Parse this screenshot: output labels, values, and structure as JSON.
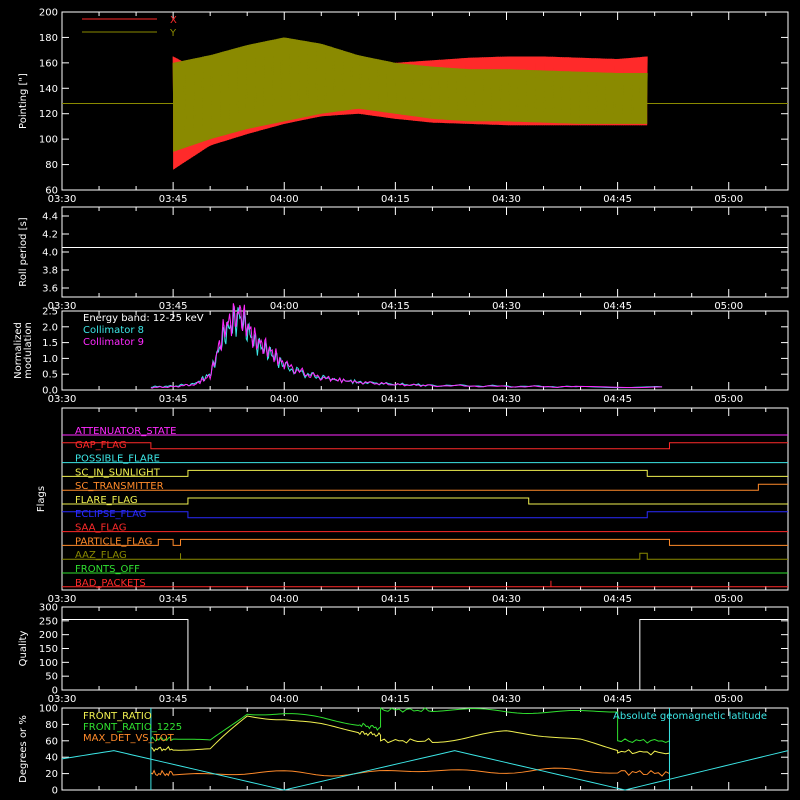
{
  "time_ticks": [
    "03:30",
    "03:45",
    "04:00",
    "04:15",
    "04:30",
    "04:45",
    "05:00"
  ],
  "colors": {
    "background": "#000000",
    "axes": "#ffffff",
    "red": "#ff2a2a",
    "olive": "#8a8a00",
    "cyan": "#3ce6e6",
    "magenta": "#ff2aff",
    "yellow": "#f0f050",
    "green": "#30e030",
    "orange": "#ff8a2a",
    "blue": "#2a2aff"
  },
  "chart_data": [
    {
      "type": "line",
      "panel": "pointing",
      "ylabel": "Pointing [\"]",
      "ylim": [
        60,
        200
      ],
      "yticks": [
        "60",
        "80",
        "100",
        "120",
        "140",
        "160",
        "180",
        "200"
      ],
      "legend_placement": "top-left",
      "series": [
        {
          "name": "X",
          "color": "#ff2a2a",
          "x": [
            "03:45",
            "03:50",
            "03:55",
            "04:00",
            "04:05",
            "04:10",
            "04:15",
            "04:20",
            "04:25",
            "04:30",
            "04:35",
            "04:40",
            "04:45",
            "04:49"
          ],
          "upper": [
            165,
            150,
            152,
            154,
            156,
            158,
            160,
            162,
            164,
            165,
            165,
            164,
            163,
            165
          ],
          "lower": [
            76,
            95,
            104,
            112,
            118,
            120,
            116,
            113,
            112,
            111,
            111,
            111,
            111,
            111
          ]
        },
        {
          "name": "Y",
          "color": "#8a8a00",
          "reference_line": 128,
          "x": [
            "03:45",
            "03:50",
            "03:55",
            "04:00",
            "04:05",
            "04:10",
            "04:15",
            "04:20",
            "04:25",
            "04:30",
            "04:35",
            "04:40",
            "04:45",
            "04:49"
          ],
          "upper": [
            160,
            166,
            174,
            180,
            175,
            166,
            160,
            157,
            155,
            155,
            154,
            153,
            152,
            152
          ],
          "lower": [
            90,
            100,
            108,
            114,
            120,
            124,
            120,
            116,
            114,
            114,
            113,
            112,
            112,
            112
          ]
        }
      ]
    },
    {
      "type": "line",
      "panel": "roll_period",
      "ylabel": "Roll period [s]",
      "ylim": [
        3.5,
        4.5
      ],
      "yticks": [
        "3.6",
        "3.8",
        "4.0",
        "4.2",
        "4.4"
      ],
      "series": [
        {
          "color": "#ffffff",
          "x": [
            "03:30",
            "05:08"
          ],
          "y": [
            4.05,
            4.05
          ]
        }
      ]
    },
    {
      "type": "line",
      "panel": "modulation",
      "ylabel": "Normalized modulation",
      "ylim": [
        0,
        2.5
      ],
      "yticks": [
        "0.0",
        "0.5",
        "1.0",
        "1.5",
        "2.0",
        "2.5"
      ],
      "annotation": "Energy band: 12-25 keV",
      "series": [
        {
          "name": "Collimator 8",
          "color": "#3ce6e6",
          "x": [
            "03:42",
            "03:45",
            "03:48",
            "03:50",
            "03:52",
            "03:54",
            "03:56",
            "03:58",
            "04:00",
            "04:03",
            "04:06",
            "04:10",
            "04:15",
            "04:20",
            "04:30",
            "04:40",
            "04:51"
          ],
          "y": [
            0.1,
            0.12,
            0.2,
            0.5,
            1.8,
            2.35,
            1.5,
            1.2,
            0.75,
            0.5,
            0.35,
            0.25,
            0.18,
            0.15,
            0.12,
            0.1,
            0.1
          ]
        },
        {
          "name": "Collimator 9",
          "color": "#ff2aff",
          "x": [
            "03:42",
            "03:45",
            "03:48",
            "03:50",
            "03:52",
            "03:54",
            "03:56",
            "03:58",
            "04:00",
            "04:03",
            "04:06",
            "04:10",
            "04:15",
            "04:20",
            "04:30",
            "04:40",
            "04:51"
          ],
          "y": [
            0.08,
            0.1,
            0.18,
            0.45,
            2.0,
            2.45,
            1.6,
            1.25,
            0.8,
            0.5,
            0.35,
            0.25,
            0.17,
            0.14,
            0.11,
            0.1,
            0.1
          ]
        }
      ]
    },
    {
      "type": "line",
      "panel": "flags",
      "ylabel": "Flags",
      "series": [
        {
          "name": "ATTENUATOR_STATE",
          "color": "#ff2aff",
          "steps": [
            [
              "03:30",
              0
            ]
          ]
        },
        {
          "name": "GAP_FLAG",
          "color": "#ff2a2a",
          "steps": [
            [
              "03:30",
              1
            ],
            [
              "03:42",
              0
            ],
            [
              "04:52",
              1
            ]
          ]
        },
        {
          "name": "POSSIBLE_FLARE",
          "color": "#3ce6e6",
          "steps": [
            [
              "03:30",
              0
            ]
          ]
        },
        {
          "name": "SC_IN_SUNLIGHT",
          "color": "#f0f050",
          "steps": [
            [
              "03:30",
              0
            ],
            [
              "03:47",
              1
            ],
            [
              "04:49",
              0
            ]
          ]
        },
        {
          "name": "SC_TRANSMITTER",
          "color": "#ff8a2a",
          "steps": [
            [
              "03:30",
              0
            ],
            [
              "05:04",
              1
            ]
          ]
        },
        {
          "name": "FLARE_FLAG",
          "color": "#f0f050",
          "steps": [
            [
              "03:30",
              0
            ],
            [
              "03:47",
              1
            ],
            [
              "04:33",
              0
            ]
          ]
        },
        {
          "name": "ECLIPSE_FLAG",
          "color": "#2a2aff",
          "steps": [
            [
              "03:30",
              1
            ],
            [
              "03:47",
              0
            ],
            [
              "04:49",
              1
            ]
          ]
        },
        {
          "name": "SAA_FLAG",
          "color": "#ff2a2a",
          "steps": [
            [
              "03:30",
              0
            ]
          ]
        },
        {
          "name": "PARTICLE_FLAG",
          "color": "#ff8a2a",
          "steps": [
            [
              "03:30",
              0
            ],
            [
              "03:43",
              1
            ],
            [
              "03:45",
              0
            ],
            [
              "03:46",
              1
            ],
            [
              "04:52",
              0
            ]
          ]
        },
        {
          "name": "AAZ_FLAG",
          "color": "#8a8a00",
          "steps": [
            [
              "03:30",
              0
            ],
            [
              "03:46",
              1
            ],
            [
              "03:46",
              0
            ],
            [
              "04:48",
              1
            ],
            [
              "04:49",
              0
            ]
          ]
        },
        {
          "name": "FRONTS_OFF",
          "color": "#30e030",
          "steps": [
            [
              "03:30",
              0
            ]
          ]
        },
        {
          "name": "BAD_PACKETS",
          "color": "#ff2a2a",
          "steps": [
            [
              "03:30",
              0
            ],
            [
              "04:36",
              1
            ],
            [
              "04:36",
              0
            ]
          ]
        }
      ]
    },
    {
      "type": "line",
      "panel": "quality",
      "ylabel": "Quality",
      "ylim": [
        0,
        300
      ],
      "yticks": [
        "0",
        "50",
        "100",
        "150",
        "200",
        "250",
        "300"
      ],
      "series": [
        {
          "color": "#ffffff",
          "x": [
            "03:30",
            "03:47",
            "03:47",
            "04:48",
            "04:48",
            "05:08"
          ],
          "y": [
            255,
            255,
            0,
            0,
            255,
            255
          ]
        }
      ]
    },
    {
      "type": "line",
      "panel": "ratios",
      "ylabel": "Degrees or %",
      "ylim": [
        0,
        100
      ],
      "yticks": [
        "0",
        "20",
        "40",
        "60",
        "80",
        "100"
      ],
      "series": [
        {
          "name": "FRONT_RATIO",
          "color": "#f0f050",
          "x": [
            "03:42",
            "03:45",
            "03:50",
            "03:55",
            "04:00",
            "04:05",
            "04:10",
            "04:13",
            "04:13",
            "04:20",
            "04:25",
            "04:30",
            "04:40",
            "04:45",
            "04:45",
            "04:52"
          ],
          "y": [
            50,
            50,
            48,
            90,
            88,
            80,
            70,
            67,
            60,
            60,
            65,
            70,
            62,
            50,
            47,
            45
          ]
        },
        {
          "name": "FRONT_RATIO_1225",
          "color": "#30e030",
          "x": [
            "03:42",
            "03:45",
            "03:50",
            "03:55",
            "04:00",
            "04:05",
            "04:10",
            "04:13",
            "04:13",
            "04:20",
            "04:30",
            "04:40",
            "04:45",
            "04:45",
            "04:52"
          ],
          "y": [
            62,
            62,
            60,
            95,
            92,
            87,
            80,
            75,
            98,
            97,
            96,
            96,
            95,
            60,
            60
          ]
        },
        {
          "name": "MAX_DET_VS_TOT",
          "color": "#ff8a2a",
          "x": [
            "03:42",
            "03:45",
            "04:00",
            "04:15",
            "04:30",
            "04:45",
            "04:52"
          ],
          "y": [
            20,
            20,
            20,
            22,
            24,
            22,
            20
          ]
        },
        {
          "name": "Absolute geomagnetic latitude",
          "color": "#3ce6e6",
          "x": [
            "03:30",
            "03:37",
            "04:00",
            "04:23",
            "04:46",
            "05:08"
          ],
          "y": [
            38,
            48,
            0,
            48,
            0,
            48
          ]
        }
      ]
    }
  ]
}
